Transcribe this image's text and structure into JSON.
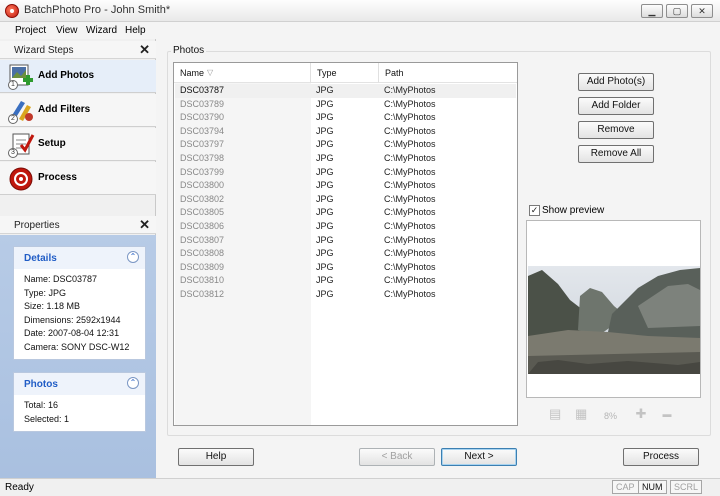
{
  "window": {
    "title": "BatchPhoto Pro - John Smith*",
    "min_glyph": "▁",
    "max_glyph": "▢",
    "close_glyph": "✕"
  },
  "menu": [
    {
      "label": "Project"
    },
    {
      "label": "View"
    },
    {
      "label": "Wizard"
    },
    {
      "label": "Help"
    }
  ],
  "wizard": {
    "header": "Wizard Steps",
    "close_glyph": "✕",
    "steps": [
      {
        "label": "Add Photos",
        "num": "1",
        "icon": "add-photos-icon",
        "active": true
      },
      {
        "label": "Add Filters",
        "num": "2",
        "icon": "add-filters-icon",
        "active": false
      },
      {
        "label": "Setup",
        "num": "3",
        "icon": "setup-icon",
        "active": false
      },
      {
        "label": "Process",
        "num": "",
        "icon": "process-icon",
        "active": false
      }
    ]
  },
  "properties": {
    "header": "Properties",
    "close_glyph": "✕",
    "details": {
      "title": "Details",
      "lines": [
        "Name: DSC03787",
        "Type: JPG",
        "Size: 1.18 MB",
        "Dimensions: 2592x1944",
        "Date: 2007-08-04 12:31",
        "Camera: SONY DSC-W12"
      ]
    },
    "photos": {
      "title": "Photos",
      "lines": [
        "Total: 16",
        "Selected: 1"
      ]
    },
    "collapse_glyph": "⌃"
  },
  "photos_panel": {
    "legend": "Photos",
    "columns": {
      "name": "Name",
      "type": "Type",
      "path": "Path",
      "sort_glyph": "▽"
    },
    "rows": [
      {
        "name": "DSC03787",
        "type": "JPG",
        "path": "C:\\MyPhotos"
      },
      {
        "name": "DSC03789",
        "type": "JPG",
        "path": "C:\\MyPhotos"
      },
      {
        "name": "DSC03790",
        "type": "JPG",
        "path": "C:\\MyPhotos"
      },
      {
        "name": "DSC03794",
        "type": "JPG",
        "path": "C:\\MyPhotos"
      },
      {
        "name": "DSC03797",
        "type": "JPG",
        "path": "C:\\MyPhotos"
      },
      {
        "name": "DSC03798",
        "type": "JPG",
        "path": "C:\\MyPhotos"
      },
      {
        "name": "DSC03799",
        "type": "JPG",
        "path": "C:\\MyPhotos"
      },
      {
        "name": "DSC03800",
        "type": "JPG",
        "path": "C:\\MyPhotos"
      },
      {
        "name": "DSC03802",
        "type": "JPG",
        "path": "C:\\MyPhotos"
      },
      {
        "name": "DSC03805",
        "type": "JPG",
        "path": "C:\\MyPhotos"
      },
      {
        "name": "DSC03806",
        "type": "JPG",
        "path": "C:\\MyPhotos"
      },
      {
        "name": "DSC03807",
        "type": "JPG",
        "path": "C:\\MyPhotos"
      },
      {
        "name": "DSC03808",
        "type": "JPG",
        "path": "C:\\MyPhotos"
      },
      {
        "name": "DSC03809",
        "type": "JPG",
        "path": "C:\\MyPhotos"
      },
      {
        "name": "DSC03810",
        "type": "JPG",
        "path": "C:\\MyPhotos"
      },
      {
        "name": "DSC03812",
        "type": "JPG",
        "path": "C:\\MyPhotos"
      }
    ],
    "selected_index": 0
  },
  "actions": {
    "add_photos": "Add Photo(s)",
    "add_folder": "Add Folder",
    "remove": "Remove",
    "remove_all": "Remove All"
  },
  "preview": {
    "show_label": "Show preview",
    "show_checked": true,
    "check_glyph": "✓",
    "zoom": "8%",
    "icons": {
      "fit": "▤",
      "actual": "▦",
      "zoom_in": "✚",
      "zoom_out": "▬"
    }
  },
  "footer": {
    "help": "Help",
    "back": "< Back",
    "next": "Next >",
    "process": "Process"
  },
  "status": {
    "text": "Ready",
    "cap": "CAP",
    "num": "NUM",
    "scrl": "SCRL"
  },
  "colors": {
    "accent": "#215dc6",
    "panel_blue": "#b7cbe6",
    "logo_red": "#c0170d"
  }
}
